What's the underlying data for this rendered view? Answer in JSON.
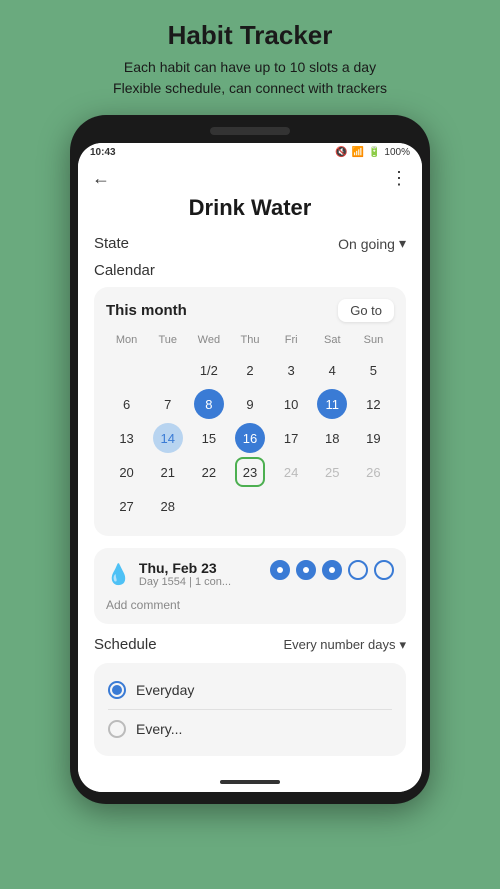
{
  "page": {
    "title": "Habit Tracker",
    "subtitle_line1": "Each habit can have up to 10 slots a day",
    "subtitle_line2": "Flexible schedule, can connect with trackers"
  },
  "status_bar": {
    "time": "10:43",
    "battery": "100%",
    "icons": "🔇 📶 🔋"
  },
  "nav": {
    "back_label": "←",
    "more_label": "⋮"
  },
  "habit": {
    "name": "Drink Water",
    "state_label": "State",
    "state_value": "On going",
    "calendar_label": "Calendar"
  },
  "calendar": {
    "month_label": "This month",
    "go_to_label": "Go to",
    "day_headers": [
      "Mon",
      "Tue",
      "Wed",
      "Thu",
      "Fri",
      "Sat",
      "Sun"
    ],
    "weeks": [
      [
        {
          "label": "",
          "type": "empty"
        },
        {
          "label": "",
          "type": "empty"
        },
        {
          "label": "1/2",
          "type": "plain"
        },
        {
          "label": "2",
          "type": "plain"
        },
        {
          "label": "3",
          "type": "plain"
        },
        {
          "label": "4",
          "type": "plain"
        },
        {
          "label": "5",
          "type": "plain"
        }
      ],
      [
        {
          "label": "6",
          "type": "plain"
        },
        {
          "label": "7",
          "type": "plain"
        },
        {
          "label": "8",
          "type": "filled"
        },
        {
          "label": "9",
          "type": "plain"
        },
        {
          "label": "10",
          "type": "plain"
        },
        {
          "label": "11",
          "type": "filled"
        },
        {
          "label": "12",
          "type": "plain"
        }
      ],
      [
        {
          "label": "13",
          "type": "plain"
        },
        {
          "label": "14",
          "type": "light"
        },
        {
          "label": "15",
          "type": "plain"
        },
        {
          "label": "16",
          "type": "filled"
        },
        {
          "label": "17",
          "type": "plain"
        },
        {
          "label": "18",
          "type": "plain"
        },
        {
          "label": "19",
          "type": "plain"
        }
      ],
      [
        {
          "label": "20",
          "type": "plain"
        },
        {
          "label": "21",
          "type": "plain"
        },
        {
          "label": "22",
          "type": "plain"
        },
        {
          "label": "23",
          "type": "today"
        },
        {
          "label": "24",
          "type": "faded"
        },
        {
          "label": "25",
          "type": "faded"
        },
        {
          "label": "26",
          "type": "faded"
        }
      ],
      [
        {
          "label": "27",
          "type": "plain"
        },
        {
          "label": "28",
          "type": "plain"
        },
        {
          "label": "",
          "type": "empty"
        },
        {
          "label": "",
          "type": "empty"
        },
        {
          "label": "",
          "type": "empty"
        },
        {
          "label": "",
          "type": "empty"
        },
        {
          "label": "",
          "type": "empty"
        }
      ]
    ]
  },
  "day_detail": {
    "date": "Thu, Feb 23",
    "sub": "Day 1554 | 1 con...",
    "slots": [
      {
        "filled": true
      },
      {
        "filled": true
      },
      {
        "filled": true
      },
      {
        "filled": false
      },
      {
        "filled": false
      }
    ],
    "add_comment": "Add comment"
  },
  "schedule": {
    "label": "Schedule",
    "value": "Every number days",
    "options": [
      {
        "label": "Everyday",
        "selected": true
      },
      {
        "label": "Every...",
        "selected": false
      }
    ]
  }
}
